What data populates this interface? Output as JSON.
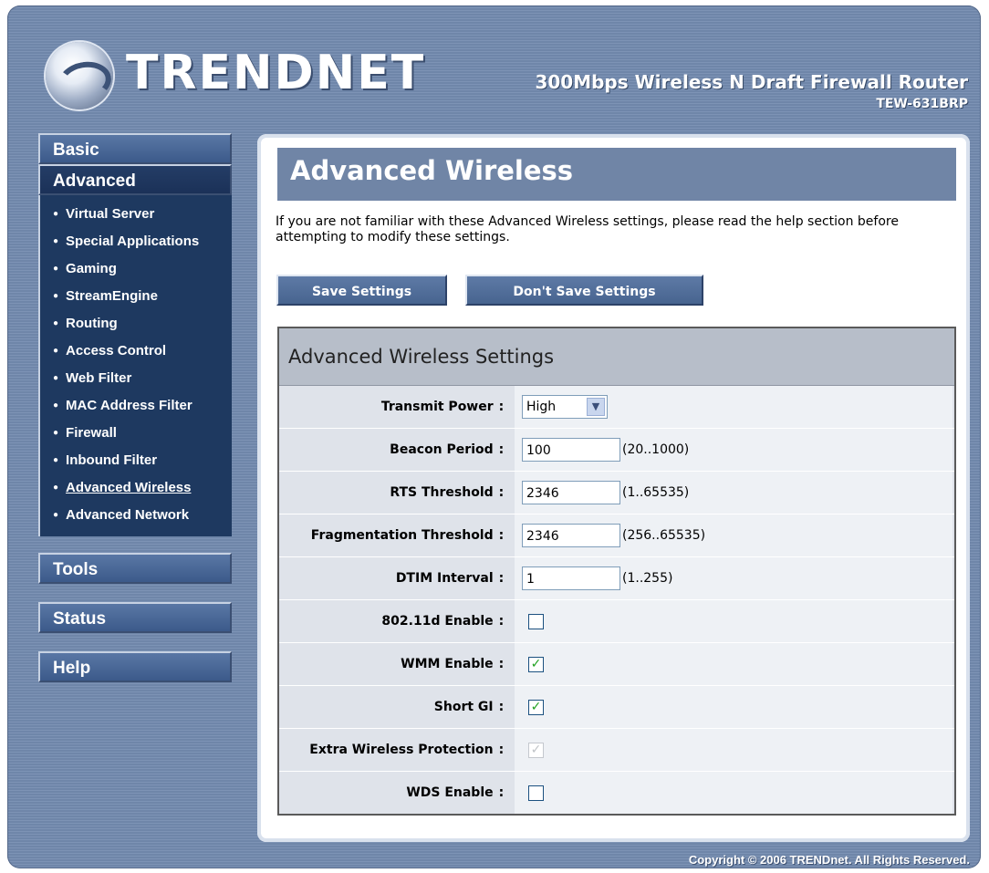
{
  "brand": {
    "logo_text": "TRENDNET",
    "product_title": "300Mbps Wireless N Draft Firewall Router",
    "model": "TEW-631BRP"
  },
  "sidebar": {
    "basic": "Basic",
    "advanced": "Advanced",
    "items": [
      {
        "label": "Virtual Server"
      },
      {
        "label": "Special Applications"
      },
      {
        "label": "Gaming"
      },
      {
        "label": "StreamEngine"
      },
      {
        "label": "Routing"
      },
      {
        "label": "Access Control"
      },
      {
        "label": "Web Filter"
      },
      {
        "label": "MAC Address Filter"
      },
      {
        "label": "Firewall"
      },
      {
        "label": "Inbound Filter"
      },
      {
        "label": "Advanced Wireless"
      },
      {
        "label": "Advanced Network"
      }
    ],
    "tools": "Tools",
    "status": "Status",
    "help": "Help"
  },
  "main": {
    "title": "Advanced Wireless",
    "intro": "If you are not familiar with these Advanced Wireless settings, please read the help section before attempting to modify these settings.",
    "save_label": "Save Settings",
    "dontsave_label": "Don't Save Settings",
    "section_title": "Advanced Wireless Settings",
    "fields": {
      "transmit_power": {
        "label": "Transmit Power",
        "value": "High"
      },
      "beacon_period": {
        "label": "Beacon Period",
        "value": "100",
        "range": "(20..1000)"
      },
      "rts_threshold": {
        "label": "RTS Threshold",
        "value": "2346",
        "range": "(1..65535)"
      },
      "fragmentation_threshold": {
        "label": "Fragmentation Threshold",
        "value": "2346",
        "range": "(256..65535)"
      },
      "dtim_interval": {
        "label": "DTIM Interval",
        "value": "1",
        "range": "(1..255)"
      },
      "dot11d_enable": {
        "label": "802.11d Enable",
        "checked": false
      },
      "wmm_enable": {
        "label": "WMM Enable",
        "checked": true
      },
      "short_gi": {
        "label": "Short GI",
        "checked": true
      },
      "extra_wireless_protection": {
        "label": "Extra Wireless Protection",
        "checked": true,
        "disabled": true
      },
      "wds_enable": {
        "label": "WDS Enable",
        "checked": false
      }
    },
    "colon": ":"
  },
  "footer": {
    "copyright": "Copyright © 2006 TRENDnet. All Rights Reserved."
  },
  "colors": {
    "frame": "#7085a6",
    "nav_dark": "#1e3960",
    "title_bar": "#7085a6",
    "check": "#21a121"
  },
  "icons": {
    "logo": "trendnet-logo-icon",
    "select_arrow": "chevron-down-icon",
    "check": "checkmark-icon"
  }
}
